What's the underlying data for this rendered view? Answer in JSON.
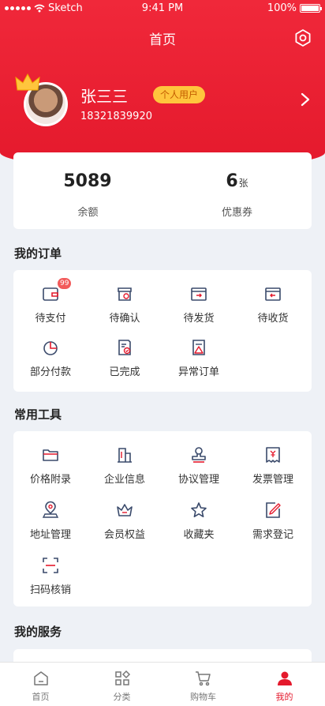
{
  "status_bar": {
    "carrier": "Sketch",
    "time": "9:41 PM",
    "battery": "100%"
  },
  "header": {
    "title": "首页"
  },
  "profile": {
    "name": "张三三",
    "badge": "个人用户",
    "phone": "18321839920"
  },
  "stats": [
    {
      "value": "5089",
      "unit": "",
      "label": "余额"
    },
    {
      "value": "6",
      "unit": "张",
      "label": "优惠券"
    }
  ],
  "orders": {
    "title": "我的订单",
    "items": [
      {
        "label": "待支付",
        "icon": "wallet-icon",
        "badge": "99"
      },
      {
        "label": "待确认",
        "icon": "clock-box-icon"
      },
      {
        "label": "待发货",
        "icon": "box-out-icon"
      },
      {
        "label": "待收货",
        "icon": "box-in-icon"
      },
      {
        "label": "部分付款",
        "icon": "pie-chart-icon"
      },
      {
        "label": "已完成",
        "icon": "doc-check-icon"
      },
      {
        "label": "异常订单",
        "icon": "doc-warning-icon"
      }
    ]
  },
  "tools": {
    "title": "常用工具",
    "items": [
      {
        "label": "价格附录",
        "icon": "folder-icon"
      },
      {
        "label": "企业信息",
        "icon": "building-icon"
      },
      {
        "label": "协议管理",
        "icon": "stamp-icon"
      },
      {
        "label": "发票管理",
        "icon": "invoice-icon"
      },
      {
        "label": "地址管理",
        "icon": "location-icon"
      },
      {
        "label": "会员权益",
        "icon": "crown-icon"
      },
      {
        "label": "收藏夹",
        "icon": "star-icon"
      },
      {
        "label": "需求登记",
        "icon": "edit-doc-icon"
      },
      {
        "label": "扫码核销",
        "icon": "scan-icon"
      }
    ]
  },
  "services": {
    "title": "我的服务"
  },
  "tabbar": {
    "items": [
      {
        "label": "首页",
        "icon": "home-icon"
      },
      {
        "label": "分类",
        "icon": "category-icon"
      },
      {
        "label": "购物车",
        "icon": "cart-icon"
      },
      {
        "label": "我的",
        "icon": "user-icon",
        "active": true
      }
    ]
  },
  "colors": {
    "primary": "#e4192c",
    "badge_bg": "#ffc53d",
    "badge_text": "#c35d00",
    "icon_stroke": "#3a4a6b",
    "background": "#eef1f6"
  }
}
